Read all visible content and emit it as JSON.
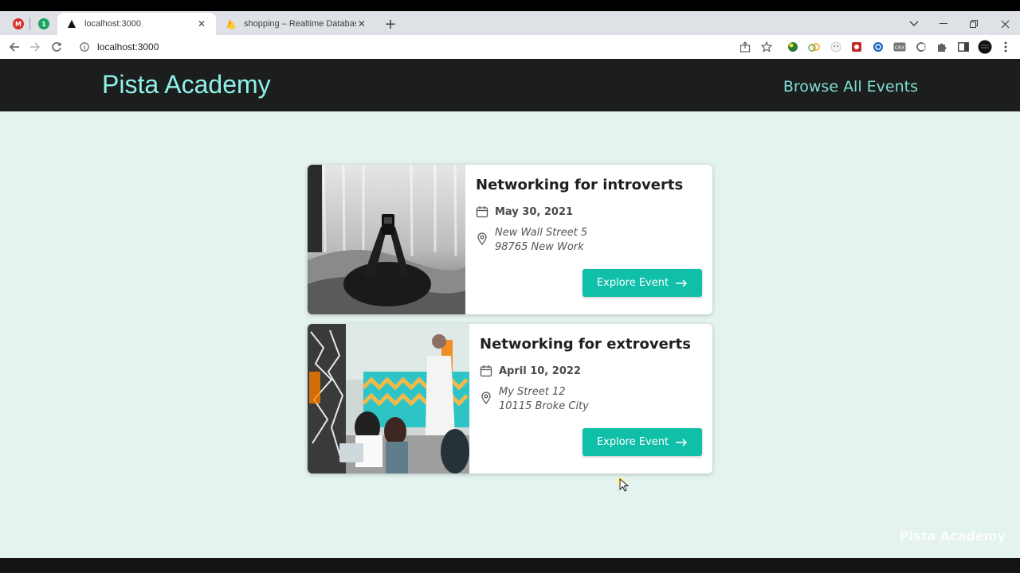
{
  "browser": {
    "tabs": [
      {
        "title": "localhost:3000",
        "active": true
      },
      {
        "title": "shopping – Realtime Database –",
        "active": false
      }
    ],
    "pinned": [
      {
        "icon": "gmail-icon",
        "color": "#d93025",
        "glyph": "M"
      },
      {
        "icon": "onepassword-icon",
        "color": "#1aa260",
        "glyph": "1"
      }
    ],
    "url": "localhost:3000"
  },
  "site": {
    "logo": "Pista Academy",
    "nav_link": "Browse All Events",
    "watermark": "Pista Academy"
  },
  "events": [
    {
      "title": "Networking for introverts",
      "date": "May 30, 2021",
      "address_line1": "New Wall Street 5",
      "address_line2": "98765 New Work",
      "button": "Explore Event",
      "image": "person-lying-with-phone-photo"
    },
    {
      "title": "Networking for extroverts",
      "date": "April 10, 2022",
      "address_line1": "My Street 12",
      "address_line2": "10115 Broke City",
      "button": "Explore Event",
      "image": "office-meeting-photo"
    }
  ],
  "colors": {
    "header_bg": "#1c1d1d",
    "logo": "#8ff2e9",
    "page_bg": "#e4f3f0",
    "accent": "#10bfa8"
  }
}
